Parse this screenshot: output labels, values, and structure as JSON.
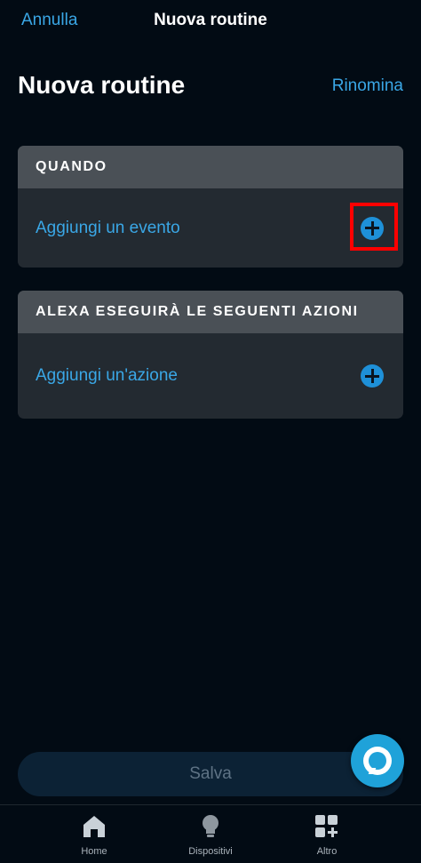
{
  "header": {
    "cancel_label": "Annulla",
    "title": "Nuova routine"
  },
  "page": {
    "title": "Nuova routine",
    "rename_label": "Rinomina"
  },
  "when_card": {
    "header": "QUANDO",
    "row_label": "Aggiungi un evento",
    "icon": "plus-circle-icon"
  },
  "actions_card": {
    "header": "ALEXA ESEGUIRÀ LE SEGUENTI AZIONI",
    "row_label": "Aggiungi un'azione",
    "icon": "plus-circle-icon"
  },
  "save_label": "Salva",
  "alexa_button": {
    "icon": "alexa-icon"
  },
  "bottom_nav": {
    "items": [
      {
        "label": "Home",
        "icon": "home-icon"
      },
      {
        "label": "Dispositivi",
        "icon": "lightbulb-icon"
      },
      {
        "label": "Altro",
        "icon": "grid-plus-icon"
      }
    ]
  },
  "colors": {
    "background": "#020b14",
    "accent": "#3aa7e6",
    "card": "#232a31",
    "card_header": "#4a5056",
    "highlight": "#ff0000"
  }
}
